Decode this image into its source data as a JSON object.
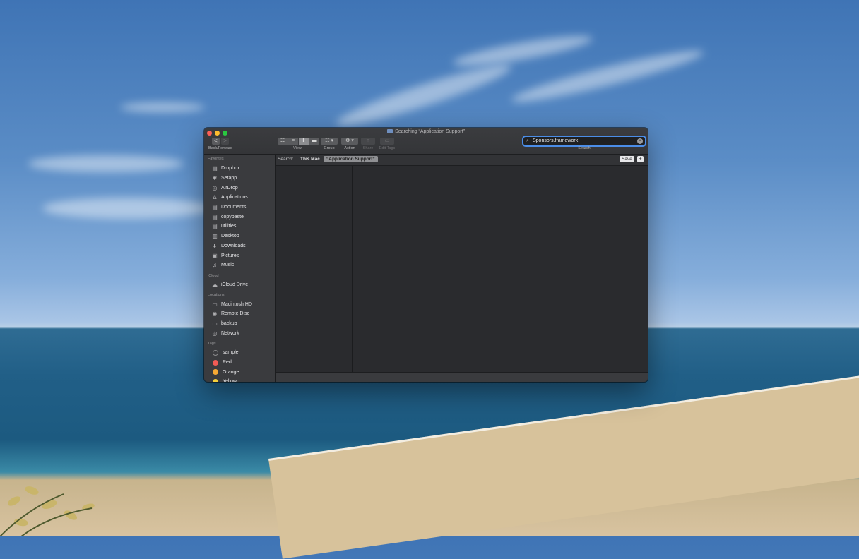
{
  "window": {
    "title": "Searching “Application Support”"
  },
  "toolbar": {
    "back_label": "<",
    "forward_label": ">",
    "back_forward_caption": "Back/Forward",
    "view_caption": "View",
    "group_caption": "Group",
    "action_caption": "Action",
    "share_caption": "Share",
    "edit_tags_caption": "Edit Tags",
    "search_caption": "Search",
    "view_icons": [
      "☷",
      "≡",
      "Ⅱ",
      "▬"
    ],
    "group_icon": "☷ ▾",
    "action_icon": "⚙ ▾",
    "share_icon": "↑",
    "edit_tags_icon": "▭"
  },
  "search": {
    "value": "Sponsors.framework",
    "clear_icon": "×",
    "magnifier_icon": "⌕"
  },
  "scope": {
    "label": "Search:",
    "this_mac": "This Mac",
    "folder_chip": "“Application Support”",
    "save_label": "Save",
    "add_label": "+"
  },
  "sidebar": {
    "favorites_title": "Favorites",
    "favorites": [
      {
        "label": "Dropbox",
        "icon": "folder-icon",
        "glyph": "▤"
      },
      {
        "label": "Setapp",
        "icon": "setapp-icon",
        "glyph": "✱"
      },
      {
        "label": "AirDrop",
        "icon": "airdrop-icon",
        "glyph": "◎"
      },
      {
        "label": "Applications",
        "icon": "applications-icon",
        "glyph": "∆"
      },
      {
        "label": "Documents",
        "icon": "documents-icon",
        "glyph": "▤"
      },
      {
        "label": "copypaste",
        "icon": "folder-icon",
        "glyph": "▤"
      },
      {
        "label": "utilities",
        "icon": "folder-icon",
        "glyph": "▤"
      },
      {
        "label": "Desktop",
        "icon": "desktop-icon",
        "glyph": "▥"
      },
      {
        "label": "Downloads",
        "icon": "downloads-icon",
        "glyph": "⬇"
      },
      {
        "label": "Pictures",
        "icon": "pictures-icon",
        "glyph": "▣"
      },
      {
        "label": "Music",
        "icon": "music-icon",
        "glyph": "♫"
      }
    ],
    "icloud_title": "iCloud",
    "icloud": [
      {
        "label": "iCloud Drive",
        "icon": "cloud-icon",
        "glyph": "☁"
      }
    ],
    "locations_title": "Locations",
    "locations": [
      {
        "label": "Macintosh HD",
        "icon": "hard-drive-icon",
        "glyph": "▭"
      },
      {
        "label": "Remote Disc",
        "icon": "disc-icon",
        "glyph": "◉"
      },
      {
        "label": "backup",
        "icon": "drive-icon",
        "glyph": "▭"
      },
      {
        "label": "Network",
        "icon": "network-icon",
        "glyph": "◎"
      }
    ],
    "tags_title": "Tags",
    "tags": [
      {
        "label": "sample",
        "color": "#3a3b3e",
        "border": "#8a8a8c"
      },
      {
        "label": "Red",
        "color": "#f05b55",
        "border": "#f05b55"
      },
      {
        "label": "Orange",
        "color": "#f7a934",
        "border": "#f7a934"
      },
      {
        "label": "Yellow",
        "color": "#f5cf3b",
        "border": "#f5cf3b"
      }
    ]
  }
}
